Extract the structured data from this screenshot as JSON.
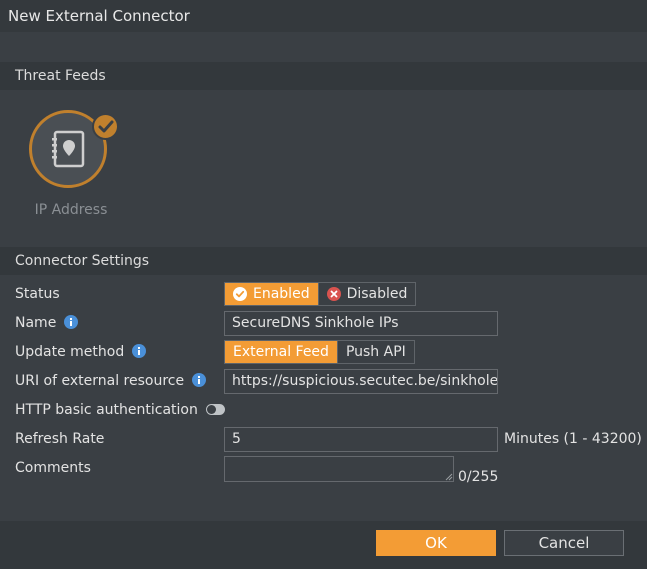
{
  "dialog": {
    "title": "New External Connector"
  },
  "threat_feeds": {
    "header": "Threat Feeds",
    "selected_feed": {
      "label": "IP Address",
      "icon": "address-book-pin-icon",
      "selected": true
    }
  },
  "connector_settings": {
    "header": "Connector Settings",
    "status": {
      "label": "Status",
      "options": [
        "Enabled",
        "Disabled"
      ],
      "selected": "Enabled"
    },
    "name": {
      "label": "Name",
      "value": "SecureDNS Sinkhole IPs"
    },
    "update_method": {
      "label": "Update method",
      "options": [
        "External Feed",
        "Push API"
      ],
      "selected": "External Feed"
    },
    "uri": {
      "label": "URI of external resource",
      "value": "https://suspicious.secutec.be/sinkhole-a"
    },
    "http_auth": {
      "label": "HTTP basic authentication",
      "enabled": false
    },
    "refresh_rate": {
      "label": "Refresh Rate",
      "value": "5",
      "unit": "Minutes (1 - 43200)"
    },
    "comments": {
      "label": "Comments",
      "value": "",
      "counter": "0/255"
    }
  },
  "footer": {
    "ok_label": "OK",
    "cancel_label": "Cancel"
  },
  "colors": {
    "accent": "#f39c35",
    "tile_ring": "#c0802d",
    "info_blue": "#4a90d9",
    "disabled_red": "#d9534f"
  }
}
